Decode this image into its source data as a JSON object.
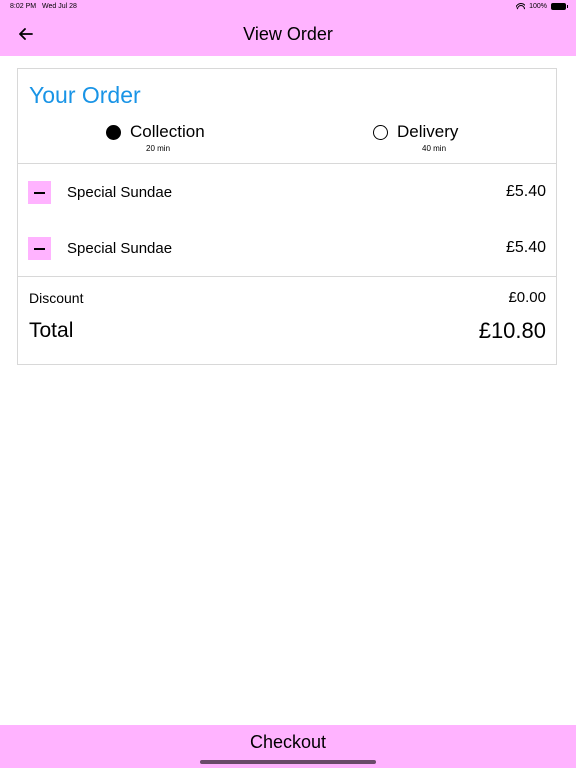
{
  "status_bar": {
    "time": "8:02 PM",
    "date": "Wed Jul 28",
    "battery": "100%",
    "icons": [
      "wifi-icon",
      "battery-icon"
    ]
  },
  "nav": {
    "title": "View Order",
    "back_icon": "arrow-left-icon"
  },
  "order": {
    "heading": "Your Order",
    "options": [
      {
        "label": "Collection",
        "time": "20 min",
        "selected": true
      },
      {
        "label": "Delivery",
        "time": "40 min",
        "selected": false
      }
    ],
    "items": [
      {
        "name": "Special Sundae",
        "price": "£5.40"
      },
      {
        "name": "Special Sundae",
        "price": "£5.40"
      }
    ],
    "discount_label": "Discount",
    "discount_value": "£0.00",
    "total_label": "Total",
    "total_value": "£10.80"
  },
  "checkout": {
    "label": "Checkout"
  },
  "colors": {
    "accent_pink": "#ffb3ff",
    "heading_blue": "#1994e6",
    "border": "#d8d8d8"
  }
}
